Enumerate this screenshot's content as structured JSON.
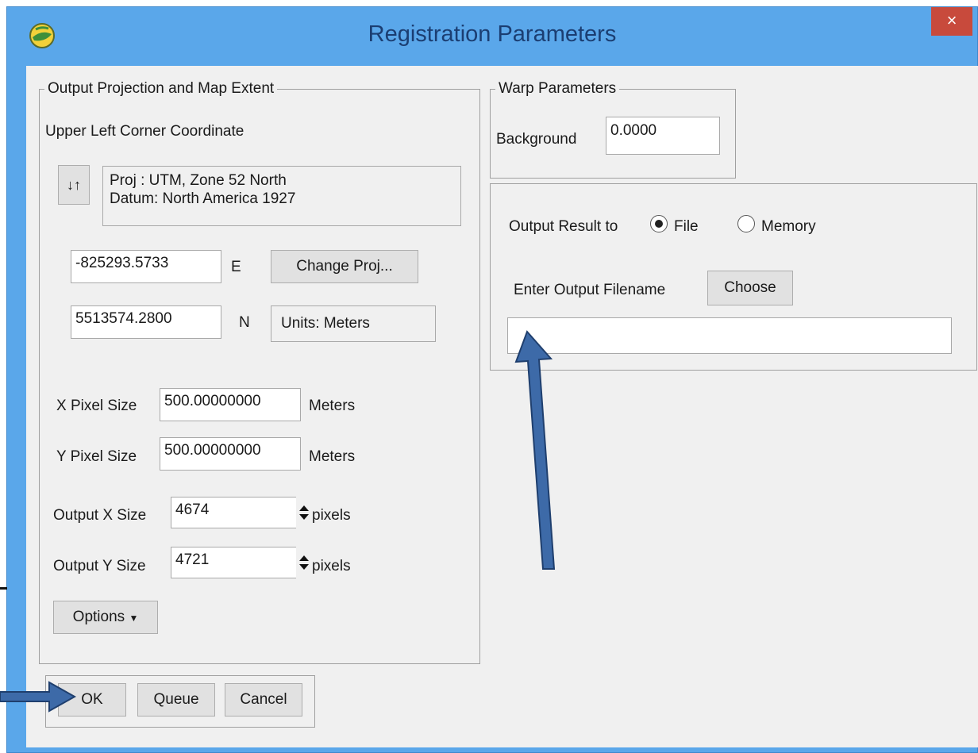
{
  "window": {
    "title": "Registration Parameters",
    "close_glyph": "×"
  },
  "projection_group": {
    "legend": "Output Projection and Map Extent",
    "corner_label": "Upper Left Corner Coordinate",
    "swap_icon_glyph": "↓↑",
    "proj_line": "Proj : UTM, Zone 52 North",
    "datum_line": "Datum: North America 1927",
    "easting": {
      "value": "-825293.5733",
      "unit": "E"
    },
    "northing": {
      "value": "5513574.2800",
      "unit": "N"
    },
    "change_proj_label": "Change Proj...",
    "units_label": "Units: Meters",
    "x_pixel": {
      "label": "X Pixel Size",
      "value": "500.00000000",
      "unit": "Meters"
    },
    "y_pixel": {
      "label": "Y Pixel Size",
      "value": "500.00000000",
      "unit": "Meters"
    },
    "x_size": {
      "label": "Output X Size",
      "value": "4674",
      "unit": "pixels"
    },
    "y_size": {
      "label": "Output Y Size",
      "value": "4721",
      "unit": "pixels"
    },
    "options_label": "Options",
    "options_arrow": "▼"
  },
  "warp_group": {
    "legend": "Warp Parameters",
    "background_label": "Background",
    "background_value": "0.0000"
  },
  "output_panel": {
    "result_label": "Output Result to",
    "file_label": "File",
    "memory_label": "Memory",
    "selected": "File",
    "filename_label": "Enter Output Filename",
    "choose_label": "Choose",
    "filename_value": ""
  },
  "buttons": {
    "ok": "OK",
    "queue": "Queue",
    "cancel": "Cancel"
  },
  "colors": {
    "titlebar": "#5aa7ea",
    "title_text": "#1b3e72",
    "close_button": "#c84a3c",
    "dialog_bg": "#f0f0f0",
    "arrow_fill": "#3d6aa8",
    "arrow_stroke": "#1f3f6e"
  },
  "icons": {
    "app": "globe-icon",
    "swap": "swap-arrows-icon",
    "spinner": "spinner-arrows-icon",
    "dropdown": "caret-down-icon"
  }
}
